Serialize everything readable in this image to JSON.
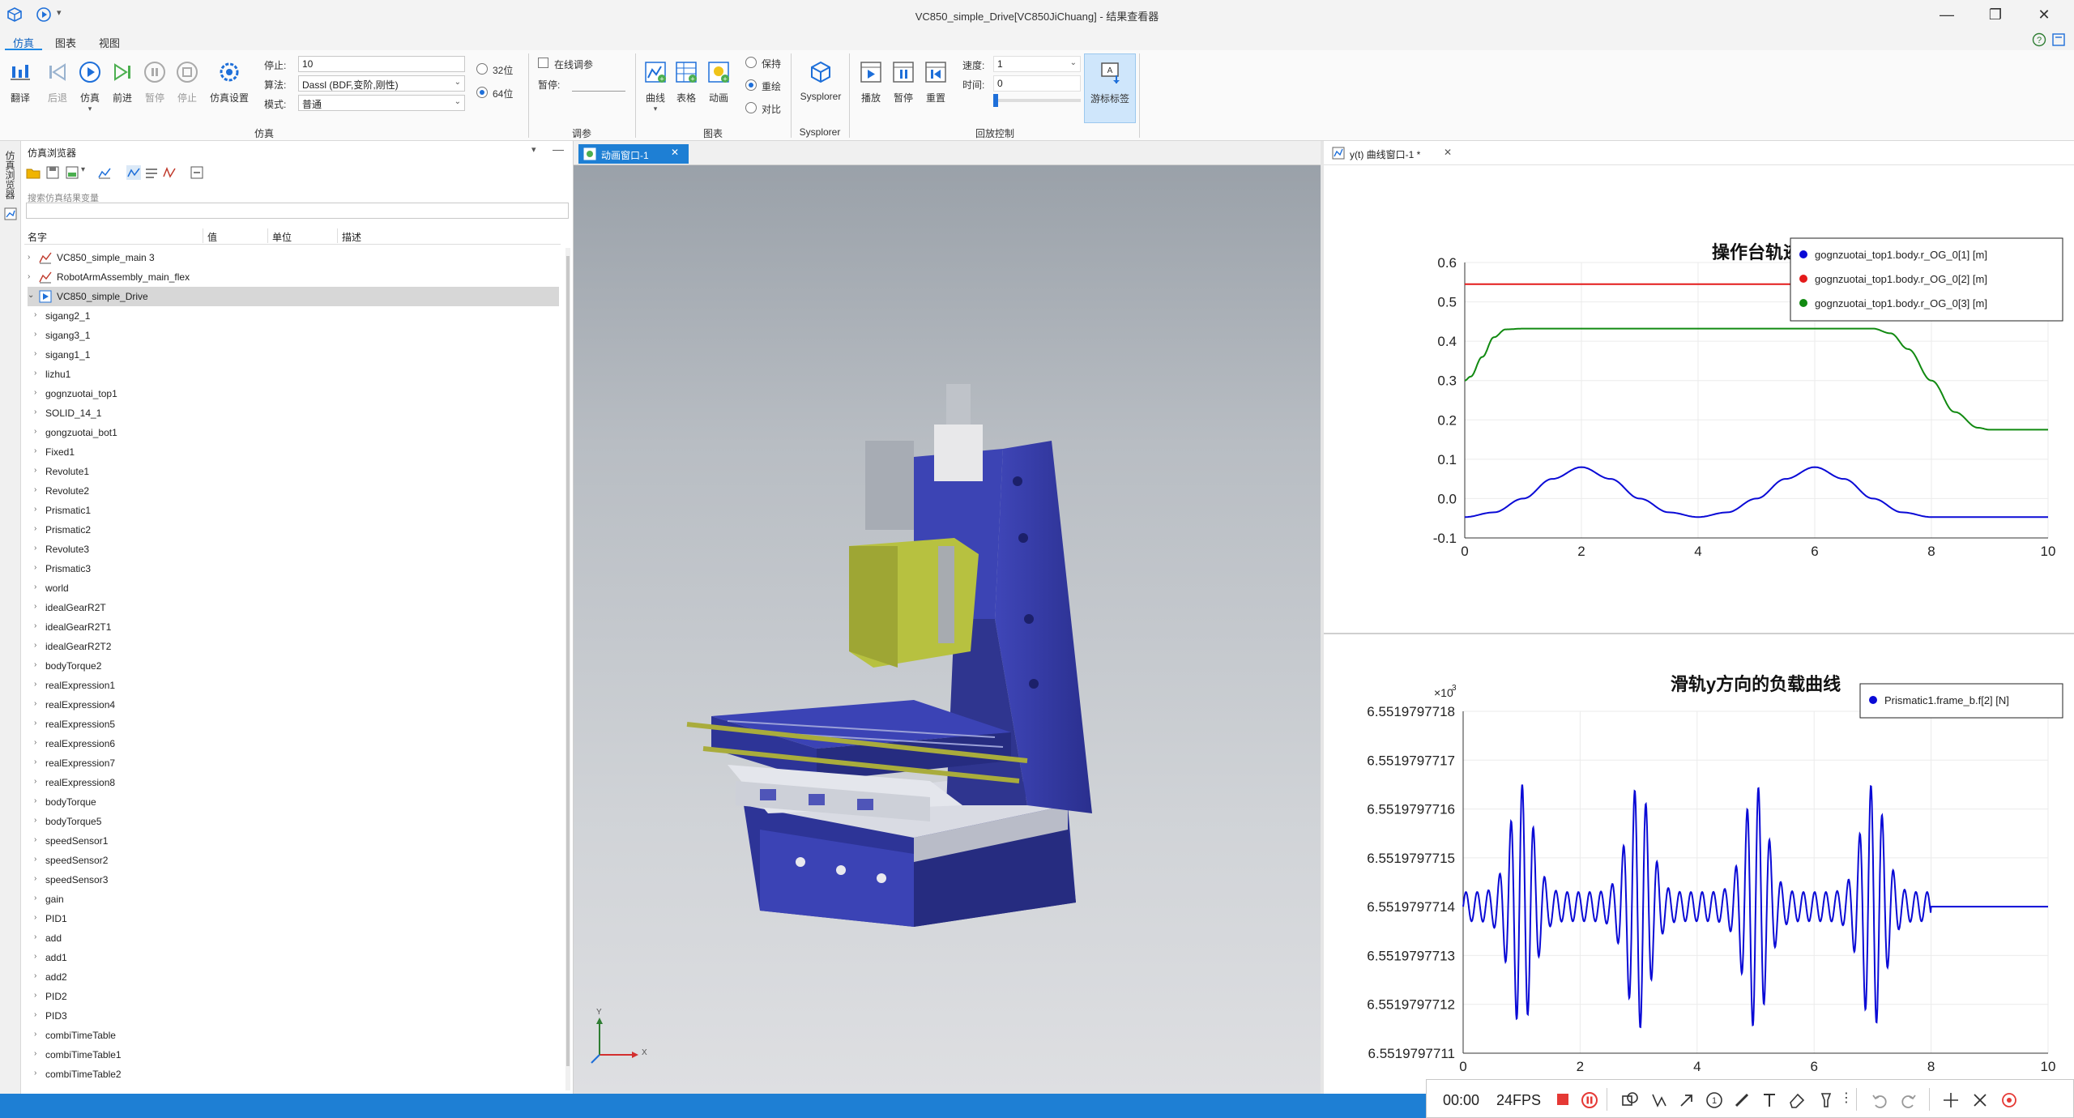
{
  "window": {
    "title": "VC850_simple_Drive[VC850JiChuang] - 结果查看器",
    "minimize": "—",
    "maximize": "❐",
    "close": "✕"
  },
  "menu": {
    "tabs": [
      "仿真",
      "图表",
      "视图"
    ]
  },
  "ribbon": {
    "sim_buttons": [
      {
        "label": "翻译",
        "icon": "translate-icon",
        "state": "normal"
      },
      {
        "label": "后退",
        "icon": "step-back-icon",
        "state": "disabled"
      },
      {
        "label": "仿真",
        "icon": "play-icon",
        "state": "normal"
      },
      {
        "label": "前进",
        "icon": "step-forward-icon",
        "state": "disabled"
      },
      {
        "label": "暂停",
        "icon": "pause-icon",
        "state": "disabled"
      },
      {
        "label": "停止",
        "icon": "stop-icon",
        "state": "disabled"
      },
      {
        "label": "仿真设置",
        "icon": "sim-settings-icon",
        "state": "normal"
      }
    ],
    "stop_label": "停止:",
    "stop_value": "10",
    "algo_label": "算法:",
    "algo_value": "Dassl (BDF,变阶,刚性)",
    "mode_label": "模式:",
    "mode_value": "普通",
    "bit32": "32位",
    "bit64": "64位",
    "sim_group": "仿真",
    "online_label": "在线调参",
    "pause_label": "暂停:",
    "tune_group": "调参",
    "chart_buttons": [
      {
        "label": "曲线",
        "icon": "curve-icon"
      },
      {
        "label": "表格",
        "icon": "table-icon"
      },
      {
        "label": "动画",
        "icon": "animation-icon"
      }
    ],
    "keep": "保持",
    "overlay": "重绘",
    "compare": "对比",
    "chart_group": "图表",
    "sysplorer_label": "Sysplorer",
    "sysplorer_group": "Sysplorer",
    "playback_buttons": [
      {
        "label": "播放",
        "icon": "playback-play-icon"
      },
      {
        "label": "暂停",
        "icon": "playback-pause-icon"
      },
      {
        "label": "重置",
        "icon": "playback-reset-icon"
      }
    ],
    "speed_label": "速度:",
    "speed_value": "1",
    "time_label": "时间:",
    "time_value": "0",
    "cursor_label": "游标标签",
    "playback_group": "回放控制"
  },
  "browser": {
    "vertical_tab": "仿真浏览器",
    "title": "仿真浏览器",
    "search_placeholder": "搜索仿真结果变量",
    "columns": [
      "名字",
      "值",
      "单位",
      "描述"
    ],
    "roots": [
      "VC850_simple_main 3",
      "RobotArmAssembly_main_flex",
      "VC850_simple_Drive"
    ],
    "children": [
      "sigang2_1",
      "sigang3_1",
      "sigang1_1",
      "lizhu1",
      "gognzuotai_top1",
      "SOLID_14_1",
      "gongzuotai_bot1",
      "Fixed1",
      "Revolute1",
      "Revolute2",
      "Prismatic1",
      "Prismatic2",
      "Revolute3",
      "Prismatic3",
      "world",
      "idealGearR2T",
      "idealGearR2T1",
      "idealGearR2T2",
      "bodyTorque2",
      "realExpression1",
      "realExpression4",
      "realExpression5",
      "realExpression6",
      "realExpression7",
      "realExpression8",
      "bodyTorque",
      "bodyTorque5",
      "speedSensor1",
      "speedSensor2",
      "speedSensor3",
      "gain",
      "PID1",
      "add",
      "add1",
      "add2",
      "PID2",
      "PID3",
      "combiTimeTable",
      "combiTimeTable1",
      "combiTimeTable2"
    ]
  },
  "animation": {
    "tab_label": "动画窗口-1",
    "axis_x": "X",
    "axis_y": "Y"
  },
  "curve_window": {
    "tab_label": "y(t) 曲线窗口-1 *"
  },
  "chart_data": [
    {
      "type": "line",
      "title": "操作台轨迹",
      "xlabel": "",
      "ylabel": "",
      "xlim": [
        0,
        10
      ],
      "ylim": [
        -0.1,
        0.6
      ],
      "xticks": [
        "0",
        "2",
        "4",
        "6",
        "8",
        "10"
      ],
      "yticks": [
        "-0.1",
        "0.0",
        "0.1",
        "0.2",
        "0.3",
        "0.4",
        "0.5",
        "0.6"
      ],
      "legend_position": "top-right",
      "grid": true,
      "series": [
        {
          "name": "gognzuotai_top1.body.r_OG_0[1] [m]",
          "color": "#0a0ad6",
          "x": [
            0,
            0.5,
            1.0,
            1.5,
            2.0,
            2.5,
            3.0,
            3.5,
            4.0,
            4.5,
            5.0,
            5.5,
            6.0,
            6.5,
            7.0,
            7.5,
            8.0,
            8.5,
            9.0,
            9.5,
            10
          ],
          "y": [
            -0.047,
            -0.035,
            0.0,
            0.05,
            0.08,
            0.05,
            0.0,
            -0.035,
            -0.047,
            -0.035,
            0.0,
            0.05,
            0.08,
            0.05,
            0.0,
            -0.035,
            -0.047,
            -0.047,
            -0.047,
            -0.047,
            -0.047
          ]
        },
        {
          "name": "gognzuotai_top1.body.r_OG_0[2] [m]",
          "color": "#e41a1a",
          "x": [
            0,
            10
          ],
          "y": [
            0.545,
            0.545
          ]
        },
        {
          "name": "gognzuotai_top1.body.r_OG_0[3] [m]",
          "color": "#118a11",
          "x": [
            0,
            0.1,
            0.3,
            0.5,
            0.7,
            1.0,
            2.0,
            4.0,
            6.0,
            7.0,
            7.3,
            7.6,
            8.0,
            8.4,
            8.8,
            9.0,
            9.5,
            10
          ],
          "y": [
            0.3,
            0.31,
            0.36,
            0.41,
            0.43,
            0.432,
            0.432,
            0.432,
            0.432,
            0.432,
            0.42,
            0.38,
            0.3,
            0.22,
            0.18,
            0.175,
            0.175,
            0.175
          ]
        }
      ]
    },
    {
      "type": "line",
      "title": "滑轨y方向的负载曲线",
      "xlabel": "",
      "ylabel": "",
      "multiplier": "×10",
      "multiplier_exp": "3",
      "xlim": [
        0,
        10
      ],
      "ylim": [
        6.5519797711,
        6.5519797718
      ],
      "xticks": [
        "0",
        "2",
        "4",
        "6",
        "8",
        "10"
      ],
      "yticks": [
        "6.5519797711",
        "6.5519797712",
        "6.5519797713",
        "6.5519797714",
        "6.5519797715",
        "6.5519797716",
        "6.5519797717",
        "6.5519797718"
      ],
      "legend_position": "top-right",
      "grid": true,
      "series": [
        {
          "name": "Prismatic1.frame_b.f[2] [N]",
          "color": "#0a0ad6",
          "baseline": 6.5519797714,
          "amplitude": 2.5e-10,
          "bursts": [
            1.0,
            3.0,
            5.0,
            7.0
          ],
          "settle_x": 8.0
        }
      ]
    }
  ],
  "recorder": {
    "time": "00:00",
    "fps": "24FPS"
  }
}
